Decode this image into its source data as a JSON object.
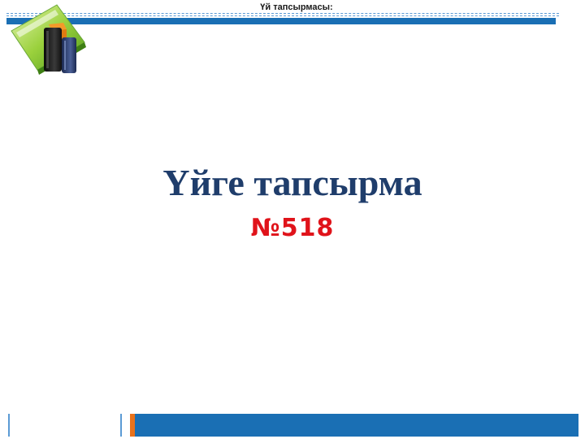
{
  "header": {
    "title": "Үй тапсырмасы:"
  },
  "logo": {
    "icon": "books-with-green-folder-icon"
  },
  "main": {
    "title": "Үйге тапсырма",
    "task_number": "№518"
  },
  "colors": {
    "accent_blue": "#1a6fb4",
    "title_navy": "#1f3d6b",
    "task_red": "#e0131a",
    "footer_orange": "#e8721c"
  }
}
